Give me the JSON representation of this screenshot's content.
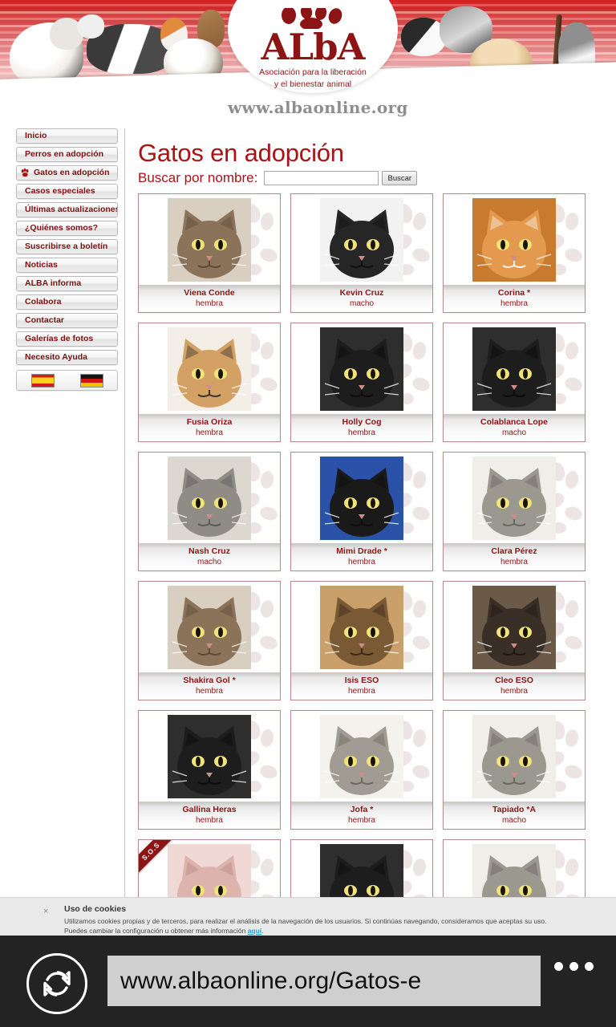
{
  "site": {
    "logo_title": "ALbA",
    "logo_subtitle_line1": "Asociación para la liberación",
    "logo_subtitle_line2": "y el bienestar animal",
    "url_banner": "www.albaonline.org"
  },
  "sidebar": {
    "items": [
      {
        "label": "Inicio",
        "active": false
      },
      {
        "label": "Perros en adopción",
        "active": false
      },
      {
        "label": "Gatos en adopción",
        "active": true
      },
      {
        "label": "Casos especiales",
        "active": false
      },
      {
        "label": "Últimas actualizaciones",
        "active": false
      },
      {
        "label": "¿Quiénes somos?",
        "active": false
      },
      {
        "label": "Suscribirse a boletín",
        "active": false
      },
      {
        "label": "Noticias",
        "active": false
      },
      {
        "label": "ALBA informa",
        "active": false
      },
      {
        "label": "Colabora",
        "active": false
      },
      {
        "label": "Contactar",
        "active": false
      },
      {
        "label": "Galerías de fotos",
        "active": false
      },
      {
        "label": "Necesito Ayuda",
        "active": false
      }
    ],
    "languages": [
      {
        "name": "spanish-flag"
      },
      {
        "name": "german-flag"
      }
    ]
  },
  "main": {
    "page_title": "Gatos en adopción",
    "search_label": "Buscar por nombre:",
    "search_value": "",
    "search_placeholder": "",
    "search_button": "Buscar",
    "cats": [
      {
        "name": "Viena Conde",
        "sex": "hembra",
        "sos": false,
        "coat": "brown-tabby"
      },
      {
        "name": "Kevin Cruz",
        "sex": "macho",
        "sos": false,
        "coat": "black-white"
      },
      {
        "name": "Corina *",
        "sex": "hembra",
        "sos": false,
        "coat": "orange-white"
      },
      {
        "name": "Fusia Oriza",
        "sex": "hembra",
        "sos": false,
        "coat": "calico"
      },
      {
        "name": "Holly Cog",
        "sex": "hembra",
        "sos": false,
        "coat": "black"
      },
      {
        "name": "Colablanca Lope",
        "sex": "macho",
        "sos": false,
        "coat": "black"
      },
      {
        "name": "Nash Cruz",
        "sex": "macho",
        "sos": false,
        "coat": "grey-tabby"
      },
      {
        "name": "Mimi Drade *",
        "sex": "hembra",
        "sos": false,
        "coat": "black-blue"
      },
      {
        "name": "Clara Pérez",
        "sex": "hembra",
        "sos": false,
        "coat": "grey-white"
      },
      {
        "name": "Shakira Gol *",
        "sex": "hembra",
        "sos": false,
        "coat": "brown-tabby"
      },
      {
        "name": "Isis ESO",
        "sex": "hembra",
        "sos": false,
        "coat": "tortoiseshell"
      },
      {
        "name": "Cleo ESO",
        "sex": "hembra",
        "sos": false,
        "coat": "dark-tabby"
      },
      {
        "name": "Gallina Heras",
        "sex": "hembra",
        "sos": false,
        "coat": "black"
      },
      {
        "name": "Jofa *",
        "sex": "hembra",
        "sos": false,
        "coat": "grey-white-tabby"
      },
      {
        "name": "Tapiado *A",
        "sex": "macho",
        "sos": false,
        "coat": "grey-white"
      },
      {
        "name": "",
        "sex": "",
        "sos": true,
        "coat": "pink-sphynx"
      },
      {
        "name": "",
        "sex": "",
        "sos": false,
        "coat": "black"
      },
      {
        "name": "",
        "sex": "",
        "sos": false,
        "coat": "grey-white"
      }
    ],
    "sos_badge": "S.O.S"
  },
  "cookie_notice": {
    "close_icon": "×",
    "title": "Uso de cookies",
    "line1": "Utilizamos cookies propias y de terceros, para realizar el análisis de la navegación de los usuarios. Si continúas navegando, consideramos que aceptas su uso.",
    "line2_pre": "Puedes cambiar la configuración u obtener más información ",
    "line2_link": "aquí",
    "line2_post": "."
  },
  "browser": {
    "refresh_icon": "refresh-icon",
    "url": "www.albaonline.org/Gatos-e",
    "menu_icon": "more-options-icon"
  },
  "colors": {
    "brand_red": "#8c1414",
    "title_red": "#a81414",
    "banner_red": "#d41b1b",
    "chrome_dark": "#232323",
    "cookie_bg": "#e9e9e9",
    "link_blue": "#2a9fd6"
  }
}
